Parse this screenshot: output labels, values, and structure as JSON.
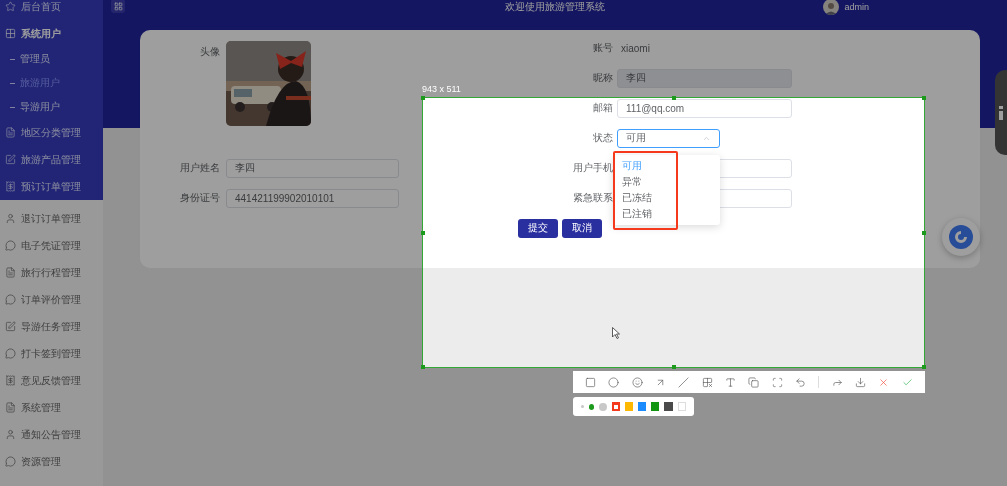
{
  "sidebar": {
    "top_items": [
      {
        "label": "后台首页",
        "kind": "star",
        "selected": false
      },
      {
        "label": "系统用户",
        "kind": "grid",
        "selected": false,
        "expanded": true,
        "children": [
          {
            "label": "管理员",
            "selected": false
          },
          {
            "label": "旅游用户",
            "selected": true
          },
          {
            "label": "导游用户",
            "selected": false
          }
        ]
      },
      {
        "label": "地区分类管理",
        "kind": "doc",
        "selected": false
      },
      {
        "label": "旅游产品管理",
        "kind": "edit",
        "selected": false
      },
      {
        "label": "预订订单管理",
        "kind": "receipt",
        "selected": false
      }
    ],
    "items": [
      {
        "label": "退订订单管理",
        "kind": "user",
        "selected": false
      },
      {
        "label": "电子凭证管理",
        "kind": "chat",
        "selected": false
      },
      {
        "label": "旅行行程管理",
        "kind": "doc",
        "selected": false
      },
      {
        "label": "订单评价管理",
        "kind": "chat",
        "selected": false
      },
      {
        "label": "导游任务管理",
        "kind": "edit",
        "selected": false
      },
      {
        "label": "打卡签到管理",
        "kind": "chat",
        "selected": false
      },
      {
        "label": "意见反馈管理",
        "kind": "receipt",
        "selected": false
      },
      {
        "label": "系统管理",
        "kind": "doc",
        "selected": false
      },
      {
        "label": "通知公告管理",
        "kind": "user",
        "selected": false
      },
      {
        "label": "资源管理",
        "kind": "chat",
        "selected": false
      }
    ]
  },
  "header": {
    "title": "欢迎使用旅游管理系统",
    "user": "admin"
  },
  "form": {
    "avatar_label": "头像",
    "left_fields": [
      {
        "label": "用户姓名",
        "value": "李四"
      },
      {
        "label": "身份证号",
        "value": "441421199902010101"
      }
    ],
    "right_fields": [
      {
        "kind": "text",
        "label": "账号",
        "value": "xiaomi"
      },
      {
        "kind": "input",
        "label": "昵称",
        "value": "李四",
        "disabled": true
      },
      {
        "kind": "input",
        "label": "邮箱",
        "value": "111@qq.com",
        "disabled": false
      },
      {
        "kind": "select",
        "label": "状态",
        "value": "可用",
        "expanded": true,
        "options": [
          {
            "label": "可用",
            "selected": true
          },
          {
            "label": "异常",
            "selected": false
          },
          {
            "label": "已冻结",
            "selected": false
          },
          {
            "label": "已注销",
            "selected": false
          }
        ]
      },
      {
        "kind": "input",
        "label": "用户手机",
        "disabled": false
      },
      {
        "kind": "input",
        "label": "紧急联系",
        "disabled": false
      }
    ],
    "buttons": [
      {
        "label": "提交"
      },
      {
        "label": "取消"
      }
    ]
  },
  "capture": {
    "size": "943 x 511",
    "tools": [
      {
        "kind": "rectangle"
      },
      {
        "kind": "circle"
      },
      {
        "kind": "emoji"
      },
      {
        "kind": "arrow"
      },
      {
        "kind": "line"
      },
      {
        "kind": "mosaic"
      },
      {
        "kind": "text"
      },
      {
        "kind": "copy"
      },
      {
        "kind": "scan"
      },
      {
        "kind": "undo"
      },
      {
        "kind": "divider"
      },
      {
        "kind": "forward"
      },
      {
        "kind": "download"
      },
      {
        "kind": "cancel"
      },
      {
        "kind": "confirm"
      }
    ],
    "pen_sizes": [
      {
        "selected": false
      },
      {
        "selected": true
      },
      {
        "selected": false
      }
    ],
    "colors": [
      {
        "color": "#f5391c",
        "selected": true
      },
      {
        "color": "#ffb800",
        "selected": false
      },
      {
        "color": "#1a8cff",
        "selected": false
      },
      {
        "color": "#129611",
        "selected": false
      },
      {
        "color": "#4a4a4a",
        "selected": false
      },
      {
        "color": "#ffffff",
        "selected": false
      }
    ]
  }
}
